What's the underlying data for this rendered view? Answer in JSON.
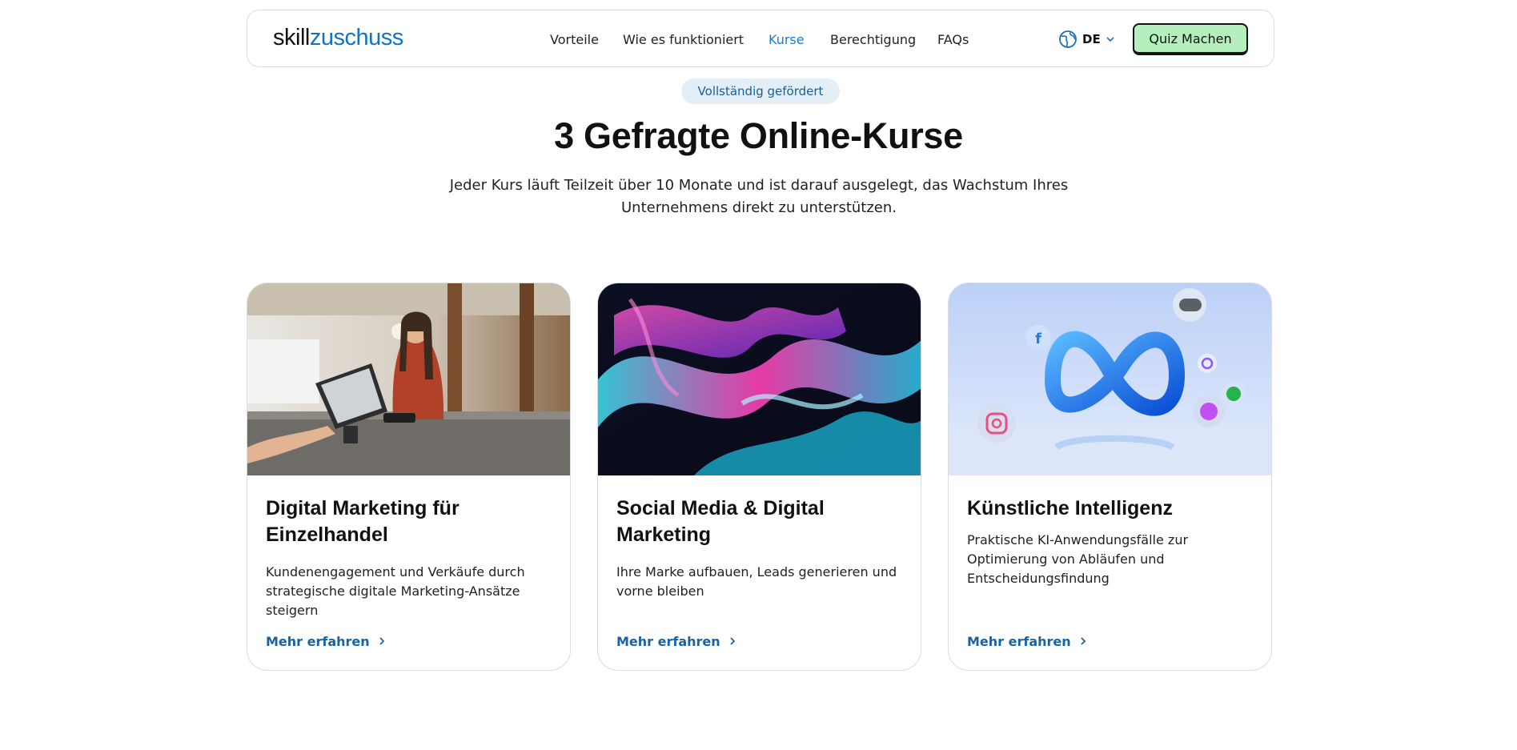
{
  "nav": {
    "logo_part1": "skill",
    "logo_part2": "zuschuss",
    "links": [
      "Vorteile",
      "Wie es funktioniert",
      "Kurse",
      "Berechtigung",
      "FAQs"
    ],
    "language": "DE",
    "quiz_button": "Quiz Machen"
  },
  "hero": {
    "badge": "Vollständig gefördert",
    "title": "3 Gefragte Online-Kurse",
    "subtitle_line1": "Jeder Kurs läuft Teilzeit über 10 Monate und ist darauf ausgelegt, das Wachstum Ihres",
    "subtitle_line2": "Unternehmens direkt zu unterstützen."
  },
  "cards": [
    {
      "title_line1": "Digital Marketing für",
      "title_line2": "Einzelhandel",
      "desc": [
        "Kundenengagement und Verkäufe durch",
        "strategische digitale Marketing-Ansätze",
        "steigern"
      ],
      "link": "Mehr erfahren"
    },
    {
      "title_line1": "Social Media & Digital",
      "title_line2": "Marketing",
      "desc": [
        "Ihre Marke aufbauen, Leads generieren und",
        "vorne bleiben"
      ],
      "link": "Mehr erfahren"
    },
    {
      "title_line1": "Künstliche Intelligenz",
      "desc": [
        "Praktische KI-Anwendungsfälle zur",
        "Optimierung von Abläufen und",
        "Entscheidungsfindung"
      ],
      "link": "Mehr erfahren"
    }
  ],
  "colors": {
    "accent_blue": "#1f7bc4",
    "quiz_green": "#b4efbd",
    "badge_bg": "#e3eef7"
  }
}
